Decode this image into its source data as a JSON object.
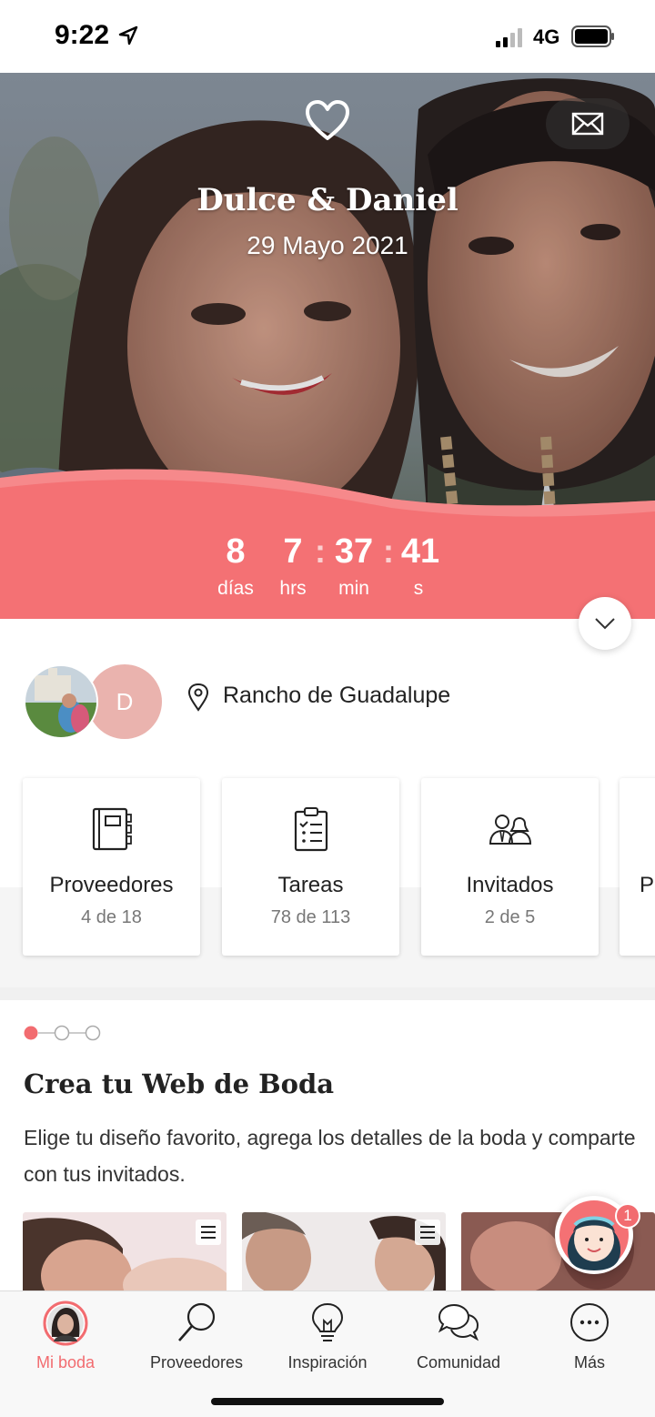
{
  "status_bar": {
    "time": "9:22",
    "network": "4G",
    "icons": [
      "location-arrow-icon",
      "signal-icon",
      "battery-icon"
    ]
  },
  "hero": {
    "couple_names": "Dulce & Daniel",
    "wedding_date": "29 Mayo 2021",
    "countdown": {
      "days": "8",
      "days_label": "días",
      "hours": "7",
      "hours_label": "hrs",
      "minutes": "37",
      "minutes_label": "min",
      "seconds": "41",
      "seconds_label": "s",
      "separator": ":"
    },
    "icons": [
      "heart-icon",
      "mail-icon",
      "chevron-down-icon"
    ]
  },
  "couple": {
    "partner_initial": "D",
    "venue": "Rancho de Guadalupe"
  },
  "cards": [
    {
      "title": "Proveedores",
      "progress": "4 de 18",
      "icon": "notebook-icon"
    },
    {
      "title": "Tareas",
      "progress": "78 de 113",
      "icon": "checklist-icon"
    },
    {
      "title": "Invitados",
      "progress": "2 de 5",
      "icon": "guests-icon"
    },
    {
      "title": "P",
      "progress": "",
      "icon": ""
    }
  ],
  "web_section": {
    "title": "Crea tu Web de Boda",
    "description": "Elige tu diseño favorito, agrega los detalles de la boda y comparte con tus invitados.",
    "pager_active": 1,
    "pager_total": 3
  },
  "chat_badge": "1",
  "tabbar": {
    "tabs": [
      {
        "label": "Mi boda",
        "icon": "profile-avatar-icon",
        "active": true
      },
      {
        "label": "Proveedores",
        "icon": "search-icon",
        "active": false
      },
      {
        "label": "Inspiración",
        "icon": "lightbulb-icon",
        "active": false
      },
      {
        "label": "Comunidad",
        "icon": "chat-bubbles-icon",
        "active": false
      },
      {
        "label": "Más",
        "icon": "more-icon",
        "active": false
      }
    ]
  },
  "colors": {
    "accent": "#f26c70",
    "countdown_band": "#f47174",
    "avatar_initial_bg": "#eab3ae"
  }
}
